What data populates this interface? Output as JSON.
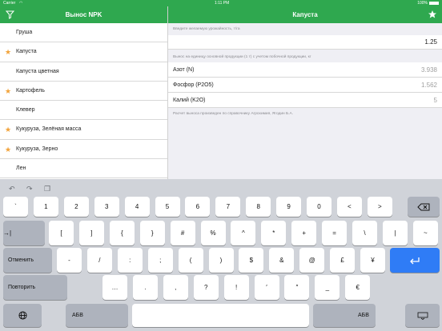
{
  "status": {
    "carrier": "Carrier",
    "time": "1:11 PM",
    "battery": "100%"
  },
  "left_nav": {
    "title": "Вынос NPK"
  },
  "right_nav": {
    "title": "Капуста"
  },
  "crops": [
    {
      "name": "Груша",
      "fav": false
    },
    {
      "name": "Капуста",
      "fav": true
    },
    {
      "name": "Капуста цветная",
      "fav": false
    },
    {
      "name": "Картофель",
      "fav": true
    },
    {
      "name": "Клевер",
      "fav": false
    },
    {
      "name": "Кукуруза, Зелёная масса",
      "fav": true
    },
    {
      "name": "Кукуруза, Зерно",
      "fav": true
    },
    {
      "name": "Лен",
      "fav": false
    }
  ],
  "form": {
    "yield_header": "Введите желаемую урожайность, т/га",
    "yield_value": "1.25",
    "removal_header": "Вынос на единицу основной продукции (1 т) с учетом побочной продукции, кг",
    "rows": [
      {
        "label": "Азот (N)",
        "value": "3.938"
      },
      {
        "label": "Фосфор (P2O5)",
        "value": "1.562"
      },
      {
        "label": "Калий (K2O)",
        "value": "5"
      }
    ],
    "footer": "Расчет выноса произведен по справочнику Агрохимия, Ягодин Б.А."
  },
  "keyboard": {
    "row1": [
      "`",
      "1",
      "2",
      "3",
      "4",
      "5",
      "6",
      "7",
      "8",
      "9",
      "0",
      "<",
      ">"
    ],
    "row2": [
      "[",
      "]",
      "{",
      "}",
      "#",
      "%",
      "^",
      "*",
      "+",
      "=",
      "\\",
      "|",
      "~"
    ],
    "row3": [
      "-",
      "/",
      ":",
      ";",
      "(",
      ")",
      "$",
      "&",
      "@",
      "£",
      "¥"
    ],
    "row4": [
      "…",
      ".",
      ",",
      "?",
      "!",
      "′",
      "″",
      "_",
      "€"
    ],
    "tab": "→|",
    "undo_key": "Отменить",
    "redo_key": "Повторить",
    "abc_left": "АБВ",
    "abc_right": "АБВ"
  },
  "colors": {
    "accent": "#2fa84f",
    "star": "#f2a33a"
  }
}
